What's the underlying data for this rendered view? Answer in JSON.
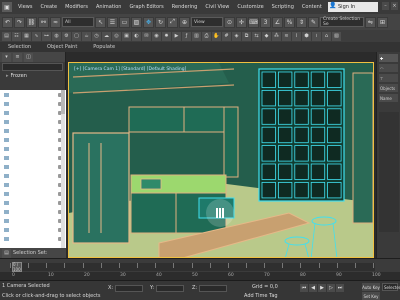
{
  "menubar": {
    "items": [
      "Views",
      "Create",
      "Modifiers",
      "Animation",
      "Graph Editors",
      "Rendering",
      "Civil View",
      "Customize",
      "Scripting",
      "Content"
    ],
    "signin_label": "Sign In"
  },
  "toolbar": {
    "filter_value": "All",
    "view_value": "View",
    "selset_value": "Create Selection Se"
  },
  "ribbon": {
    "tabs": [
      "Selection",
      "Object Paint",
      "Populate"
    ]
  },
  "scene_explorer": {
    "root_label": "Frozen",
    "selection_set_label": "Selection Set:"
  },
  "viewport": {
    "label": "[+] [Camera Cam 1] [Standard] [Default Shading]"
  },
  "command_panel": {
    "label_objects": "Objects",
    "label_name": "Name"
  },
  "timeline": {
    "frame_counter": "0 / 100",
    "ruler_ticks": [
      "0",
      "10",
      "20",
      "30",
      "40",
      "50",
      "60",
      "70",
      "80",
      "90",
      "100"
    ]
  },
  "status": {
    "line1": "1 Camera Selected",
    "line2": "Click or click-and-drag to select objects",
    "x_label": "X:",
    "y_label": "Y:",
    "z_label": "Z:",
    "x_value": "",
    "y_value": "",
    "z_value": "",
    "grid_label": "Grid = 0,0",
    "add_time_tag": "Add Time Tag",
    "autokey": "Auto Key",
    "setkey": "Set Key",
    "selected": "Selected"
  },
  "colors": {
    "accent": "#48b0e8",
    "viewport_border": "#f0c040",
    "wire_green": "#1f6b55",
    "wire_cyan": "#40e0f0"
  }
}
